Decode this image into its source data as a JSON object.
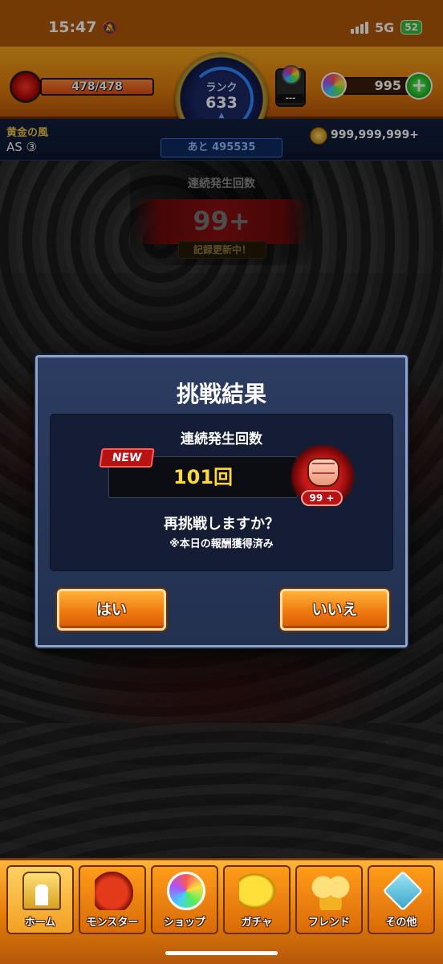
{
  "status_bar": {
    "time": "15:47",
    "network": "5G",
    "battery": "52"
  },
  "header": {
    "stamina": "478/478",
    "stamina_fraction": 1.0,
    "rank_label": "ランク",
    "rank_value": "633",
    "egg_slot": "---",
    "orbs": "995",
    "plus": "+"
  },
  "subheader": {
    "guild_name": "黄金の風",
    "guild_rank": "AS ③",
    "next_exp": "あと 495535",
    "gold": "999,999,999+"
  },
  "streak": {
    "label": "連続発生回数",
    "value": "99+",
    "record": "記録更新中！"
  },
  "dialog": {
    "title": "挑戦結果",
    "inner_label": "連続発生回数",
    "new_badge": "NEW",
    "count": "101回",
    "fist_count": "99 +",
    "question": "再挑戦しますか？",
    "note": "※本日の報酬獲得済み",
    "yes_label": "はい",
    "no_label": "いいえ"
  },
  "nav": {
    "items": [
      {
        "label": "ホーム",
        "icon": "home-icon"
      },
      {
        "label": "モンスター",
        "icon": "monster-icon"
      },
      {
        "label": "ショップ",
        "icon": "shop-orb-icon"
      },
      {
        "label": "ガチャ",
        "icon": "gacha-icon"
      },
      {
        "label": "フレンド",
        "icon": "friend-icon"
      },
      {
        "label": "その他",
        "icon": "other-icon"
      }
    ]
  },
  "colors": {
    "accent_orange": "#f07a10",
    "count_yellow": "#ffd83a",
    "new_red": "#b81313",
    "dialog_blue": "#2c3c62"
  }
}
